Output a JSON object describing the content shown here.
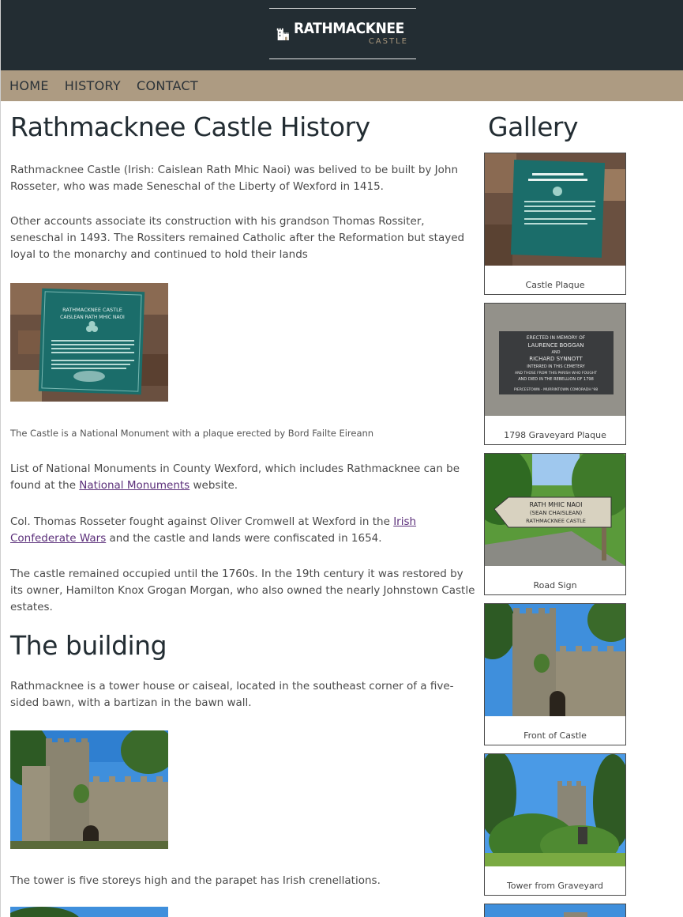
{
  "header": {
    "logo_title": "RATHMACKNEE",
    "logo_subtitle": "CASTLE"
  },
  "nav": {
    "items": [
      "HOME",
      "HISTORY",
      "CONTACT"
    ]
  },
  "main": {
    "title": "Rathmacknee Castle History",
    "p1": "Rathmacknee Castle (Irish: Caislean Rath Mhic Naoi) was belived to be built by John Rosseter, who was made Seneschal of the Liberty of Wexford in 1415.",
    "p2": "Other accounts associate its construction with his grandson Thomas Rossiter, seneschal in 1493. The Rossiters remained Catholic after the Reformation but stayed loyal to the monarchy and continued to hold their lands",
    "caption1": "The Castle is a National Monument with a plaque erected by Bord Failte Eireann",
    "p3_before": "List of National Monuments in County Wexford, which includes Rathmacknee can be found at the ",
    "p3_link": "National Monuments",
    "p3_after": " website.",
    "p4_before": "Col. Thomas Rosseter fought against Oliver Cromwell at Wexford in the ",
    "p4_link": "Irish Confederate Wars",
    "p4_after": " and the castle and lands were confiscated in 1654.",
    "p5": "The castle remained occupied until the 1760s. In the 19th century it was restored by its owner, Hamilton Knox Grogan Morgan, who also owned the nearly Johnstown Castle estates.",
    "building_title": "The building",
    "p6": "Rathmacknee is a tower house or caiseal, located in the southeast corner of a five-sided bawn, with a bartizan in the bawn wall.",
    "caption2": "The tower is five storeys high and the parapet has Irish crenellations."
  },
  "plaque": {
    "line1": "RATHMACKNEE CASTLE",
    "line2": "CAISLEAN RATH MHIC NAOI"
  },
  "memorial": {
    "line1": "ERECTED IN MEMORY OF",
    "line2": "LAURENCE BOGGAN",
    "line3": "AND",
    "line4": "RICHARD SYNNOTT",
    "line5": "INTERRED IN THIS CEMETERY",
    "line6": "AND THOSE FROM THIS PARISH WHO FOUGHT",
    "line7": "AND DIED IN THE REBELLION OF 1798",
    "line8": "PIERCESTOWN - MURRINTOWN COMORADH '98"
  },
  "sign": {
    "line1": "RATH MHIC NAOI",
    "line2": "(SEAN CHAISLEAN)",
    "line3": "RATHMACKNEE CASTLE"
  },
  "gallery": {
    "title": "Gallery",
    "items": [
      "Castle Plaque",
      "1798 Graveyard Plaque",
      "Road Sign",
      "Front of Castle",
      "Tower from Graveyard"
    ]
  },
  "colors": {
    "header_bg": "#232d33",
    "nav_bg": "#ad9b82",
    "link": "#5b2f7a"
  }
}
